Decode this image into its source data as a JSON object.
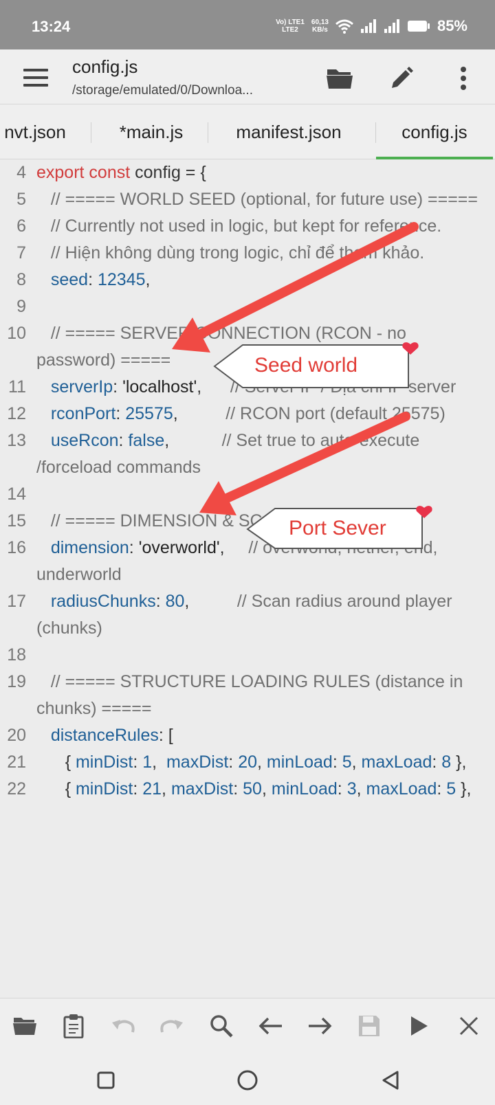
{
  "status": {
    "time": "13:24",
    "lte_line1": "Vo) LTE1",
    "lte_line2": "LTE2",
    "speed_value": "60,13",
    "speed_unit": "KB/s",
    "battery": "85%"
  },
  "toolbar": {
    "title": "config.js",
    "path": "/storage/emulated/0/Downloa..."
  },
  "tabs": [
    {
      "label": "nvt.json"
    },
    {
      "label": "*main.js"
    },
    {
      "label": "manifest.json"
    },
    {
      "label": "config.js"
    }
  ],
  "editor": {
    "line_numbers": [
      "4",
      "5",
      "",
      "6",
      "",
      "7",
      "",
      "8",
      "9",
      "10",
      "",
      "11",
      "",
      "12",
      "",
      "13",
      "",
      "14",
      "15",
      "16",
      "",
      "17",
      "",
      "18",
      "19",
      "",
      "20",
      "21",
      "",
      "22",
      ""
    ],
    "l4": {
      "kw": "export const",
      "rest": " config = {"
    },
    "l5": "   // ===== WORLD SEED (optional, for future use) =====",
    "l6": "   // Currently not used in logic, but kept for reference.",
    "l7": "   // Hiện không dùng trong logic, chỉ để tham khảo.",
    "l8": {
      "key": "seed",
      "val": "12345",
      "tail": ","
    },
    "l10": "   // ===== SERVER CONNECTION (RCON - no password) =====",
    "l11": {
      "key": "serverIp",
      "val": "'localhost'",
      "tail": ",",
      "comment": "// Server IP / Địa chỉ IP server"
    },
    "l12": {
      "key": "rconPort",
      "val": "25575",
      "tail": ",",
      "comment": "// RCON port (default 25575)"
    },
    "l13": {
      "key": "useRcon",
      "val": "false",
      "tail": ",",
      "comment": "// Set true to auto-execute /forceload commands"
    },
    "l15": "   // ===== DIMENSION & SCAN RADIUS =====",
    "l16": {
      "key": "dimension",
      "val": "'overworld'",
      "tail": ",",
      "comment": "// overworld, nether, end, underworld"
    },
    "l17": {
      "key": "radiusChunks",
      "val": "80",
      "tail": ",",
      "comment": "// Scan radius around player (chunks)"
    },
    "l19": "   // ===== STRUCTURE LOADING RULES (distance in chunks) =====",
    "l20": {
      "key": "distanceRules",
      "tail": ": ["
    },
    "l21": {
      "k1": "minDist",
      "v1": "1",
      "k2": "maxDist",
      "v2": "20",
      "k3": "minLoad",
      "v3": "5",
      "k4": "maxLoad",
      "v4": "8"
    },
    "l22": {
      "k1": "minDist",
      "v1": "21",
      "k2": "maxDist",
      "v2": "50",
      "k3": "minLoad",
      "v3": "3",
      "k4": "maxLoad",
      "v4": "5"
    }
  },
  "annotations": {
    "seed_label": "Seed world",
    "port_label": "Port Sever",
    "color": "#e13c36"
  },
  "colors": {
    "keyword": "#d13b3b",
    "identifier": "#1f5f96",
    "comment": "#707070",
    "active_tab": "#4caf50"
  }
}
